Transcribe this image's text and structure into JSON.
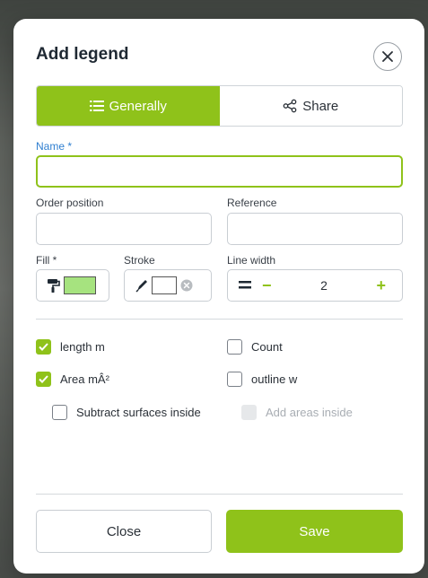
{
  "dialog": {
    "title": "Add legend",
    "close_icon": "close-icon"
  },
  "tabs": [
    {
      "label": "Generally",
      "icon": "list-icon",
      "active": true
    },
    {
      "label": "Share",
      "icon": "share-icon",
      "active": false
    }
  ],
  "fields": {
    "name_label": "Name *",
    "name_value": "",
    "order_label": "Order position",
    "order_value": "",
    "reference_label": "Reference",
    "reference_value": "",
    "fill_label": "Fill *",
    "fill_color": "#a6e37f",
    "stroke_label": "Stroke",
    "stroke_color": "#ffffff",
    "line_width_label": "Line width",
    "line_width_value": "2"
  },
  "checkboxes": {
    "length": {
      "label": "length m",
      "checked": true
    },
    "count": {
      "label": "Count",
      "checked": false
    },
    "area": {
      "label": "Area mÂ²",
      "checked": true
    },
    "outline": {
      "label": "outline w",
      "checked": false
    },
    "subtract": {
      "label": "Subtract surfaces inside",
      "checked": false
    },
    "add_areas": {
      "label": "Add areas inside",
      "checked": false,
      "disabled": true
    }
  },
  "buttons": {
    "close": "Close",
    "save": "Save"
  },
  "colors": {
    "accent": "#8fc21a",
    "label_accent": "#2f7fd0"
  }
}
